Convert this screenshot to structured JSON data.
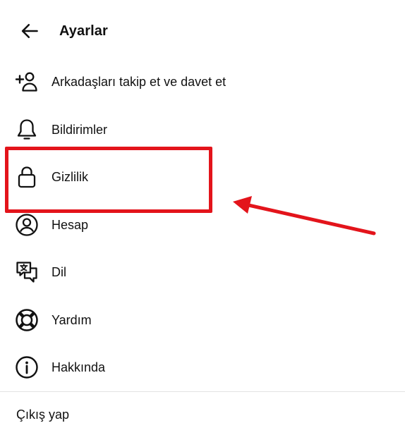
{
  "header": {
    "title": "Ayarlar",
    "back_icon": "arrow-left-icon"
  },
  "menu": {
    "items": [
      {
        "label": "Arkadaşları takip et ve davet et",
        "icon": "add-person-icon"
      },
      {
        "label": "Bildirimler",
        "icon": "bell-icon"
      },
      {
        "label": "Gizlilik",
        "icon": "lock-icon"
      },
      {
        "label": "Hesap",
        "icon": "account-circle-icon"
      },
      {
        "label": "Dil",
        "icon": "translate-icon"
      },
      {
        "label": "Yardım",
        "icon": "lifebuoy-icon"
      },
      {
        "label": "Hakkında",
        "icon": "info-icon"
      }
    ]
  },
  "logout": {
    "label": "Çıkış yap"
  },
  "annotation": {
    "highlight_color": "#e3141b",
    "highlighted_item": "Gizlilik"
  }
}
